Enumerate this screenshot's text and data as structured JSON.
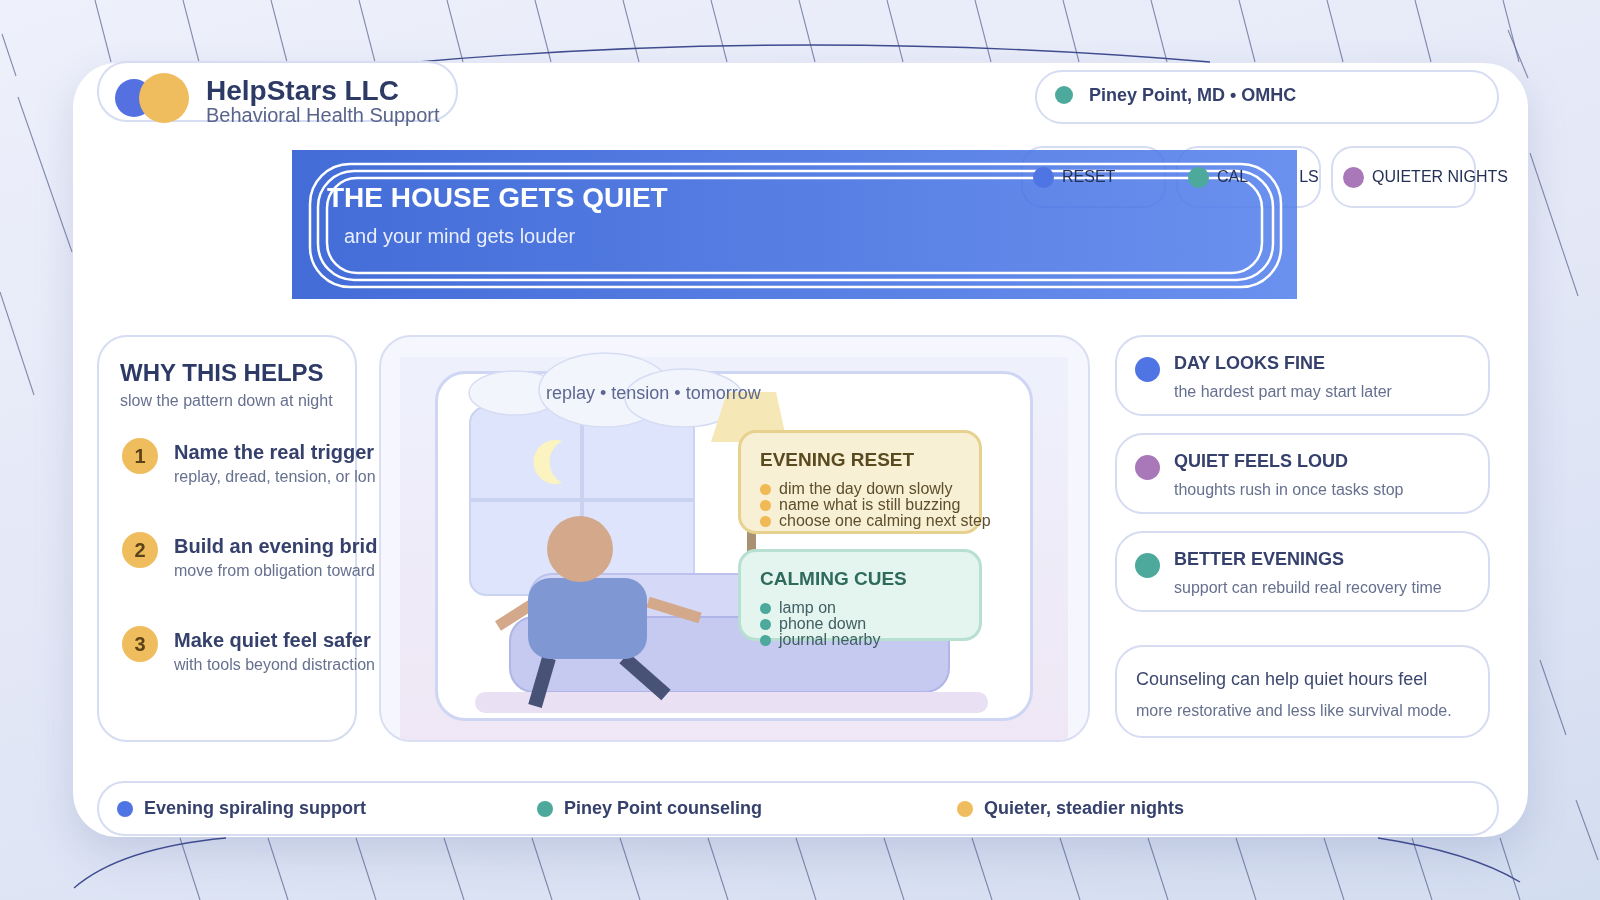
{
  "brand": {
    "name": "HelpStars LLC",
    "tagline": "Behavioral Health Support"
  },
  "location": {
    "label": "Piney Point, MD • OMHC"
  },
  "chips": [
    {
      "label": "RESET",
      "color": "#4f74e3"
    },
    {
      "label": "CAL",
      "label_end": "LS",
      "color": "#4ca99c"
    },
    {
      "label": "QUIETER NIGHTS",
      "color": "#a878b8"
    }
  ],
  "banner": {
    "title": "THE HOUSE GETS QUIET",
    "subtitle": "and your mind gets louder"
  },
  "steps_panel": {
    "title": "WHY THIS HELPS",
    "subtitle": "slow the pattern down at night",
    "steps": [
      {
        "number": "1",
        "title": "Name the real trigger",
        "text": "replay, dread, tension, or lon"
      },
      {
        "number": "2",
        "title": "Build an evening brid",
        "text": "move from obligation toward"
      },
      {
        "number": "3",
        "title": "Make quiet feel safer",
        "text": "with tools beyond distraction"
      }
    ]
  },
  "scene": {
    "thought": "replay • tension • tomorrow",
    "cards": [
      {
        "kind": "reset",
        "title": "EVENING RESET",
        "color": "#f0b955",
        "items": [
          "dim the day down slowly",
          "name what is still buzzing",
          "choose one calming next step"
        ]
      },
      {
        "kind": "cues",
        "title": "CALMING CUES",
        "color": "#4ca99c",
        "items": [
          "lamp on",
          "phone down",
          "journal nearby"
        ]
      }
    ]
  },
  "insights": [
    {
      "title": "DAY LOOKS FINE",
      "text": "the hardest part may start later",
      "color": "#4f74e3"
    },
    {
      "title": "QUIET FEELS LOUD",
      "text": "thoughts rush in once tasks stop",
      "color": "#a878b8"
    },
    {
      "title": "BETTER EVENINGS",
      "text": "support can rebuild real recovery time",
      "color": "#4ca99c"
    }
  ],
  "note": {
    "lead": "Counseling can help quiet hours feel",
    "body": "more restorative and less like survival mode."
  },
  "footer": [
    {
      "label": "Evening spiraling support",
      "color": "#4f74e3"
    },
    {
      "label": "Piney Point counseling",
      "color": "#4ca99c"
    },
    {
      "label": "Quieter, steadier nights",
      "color": "#f0bd5e"
    }
  ]
}
